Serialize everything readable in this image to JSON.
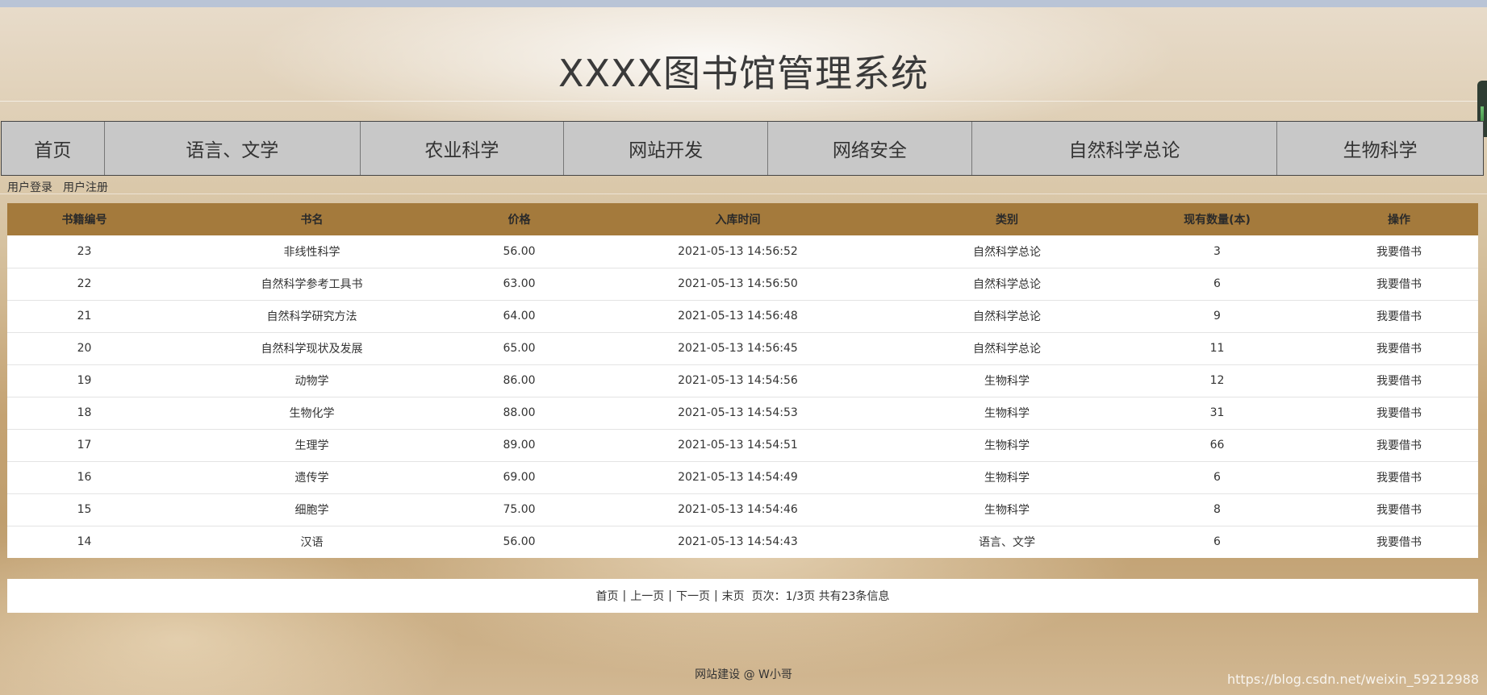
{
  "header": {
    "title": "XXXX图书馆管理系统"
  },
  "nav": {
    "items": [
      {
        "label": "首页",
        "w": 128
      },
      {
        "label": "语言、文学",
        "w": 317
      },
      {
        "label": "农业科学",
        "w": 253
      },
      {
        "label": "网站开发",
        "w": 253
      },
      {
        "label": "网络安全",
        "w": 253
      },
      {
        "label": "自然科学总论",
        "w": 379
      },
      {
        "label": "生物科学",
        "w": 255
      }
    ]
  },
  "user_links": {
    "login": "用户登录",
    "register": "用户注册"
  },
  "table": {
    "headers": [
      "书籍编号",
      "书名",
      "价格",
      "入库时间",
      "类别",
      "现有数量(本)",
      "操作"
    ],
    "rows": [
      [
        "23",
        "非线性科学",
        "56.00",
        "2021-05-13 14:56:52",
        "自然科学总论",
        "3",
        "我要借书"
      ],
      [
        "22",
        "自然科学参考工具书",
        "63.00",
        "2021-05-13 14:56:50",
        "自然科学总论",
        "6",
        "我要借书"
      ],
      [
        "21",
        "自然科学研究方法",
        "64.00",
        "2021-05-13 14:56:48",
        "自然科学总论",
        "9",
        "我要借书"
      ],
      [
        "20",
        "自然科学现状及发展",
        "65.00",
        "2021-05-13 14:56:45",
        "自然科学总论",
        "11",
        "我要借书"
      ],
      [
        "19",
        "动物学",
        "86.00",
        "2021-05-13 14:54:56",
        "生物科学",
        "12",
        "我要借书"
      ],
      [
        "18",
        "生物化学",
        "88.00",
        "2021-05-13 14:54:53",
        "生物科学",
        "31",
        "我要借书"
      ],
      [
        "17",
        "生理学",
        "89.00",
        "2021-05-13 14:54:51",
        "生物科学",
        "66",
        "我要借书"
      ],
      [
        "16",
        "遗传学",
        "69.00",
        "2021-05-13 14:54:49",
        "生物科学",
        "6",
        "我要借书"
      ],
      [
        "15",
        "细胞学",
        "75.00",
        "2021-05-13 14:54:46",
        "生物科学",
        "8",
        "我要借书"
      ],
      [
        "14",
        "汉语",
        "56.00",
        "2021-05-13 14:54:43",
        "语言、文学",
        "6",
        "我要借书"
      ]
    ]
  },
  "pager": {
    "first": "首页",
    "prev": "上一页",
    "next": "下一页",
    "last": "末页",
    "info": "页次：1/3页 共有23条信息"
  },
  "footer": {
    "text": "网站建设 @ W小哥"
  },
  "watermark": {
    "text": "https://blog.csdn.net/weixin_59212988"
  }
}
